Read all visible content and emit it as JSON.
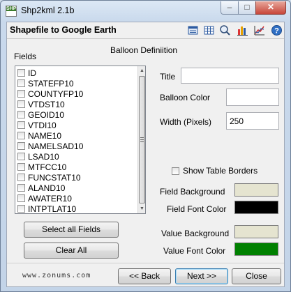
{
  "window": {
    "title": "Shp2kml 2.1b",
    "app_icon_text": "SHP"
  },
  "header": {
    "title": "Shapefile to Google Earth",
    "toolbar_icons": [
      "table-view-icon",
      "grid-icon",
      "search-icon",
      "bar-chart-icon",
      "line-chart-icon",
      "help-icon"
    ]
  },
  "balloon": {
    "heading": "Balloon Definiition"
  },
  "fields": {
    "label": "Fields",
    "items": [
      "ID",
      "STATEFP10",
      "COUNTYFP10",
      "VTDST10",
      "GEOID10",
      "VTDI10",
      "NAME10",
      "NAMELSAD10",
      "LSAD10",
      "MTFCC10",
      "FUNCSTAT10",
      "ALAND10",
      "AWATER10",
      "INTPTLAT10"
    ],
    "select_all_label": "Select all Fields",
    "clear_all_label": "Clear All"
  },
  "form": {
    "title_label": "Title",
    "title_value": "",
    "balloon_color_label": "Balloon Color",
    "balloon_color": "#ffffff",
    "width_label": "Width (Pixels)",
    "width_value": "250",
    "show_table_borders_label": "Show Table Borders",
    "show_table_borders_checked": false,
    "field_background_label": "Field Background",
    "field_background_color": "#e5e4d0",
    "field_font_color_label": "Field Font Color",
    "field_font_color": "#000000",
    "value_background_label": "Value Background",
    "value_background_color": "#e5e4d0",
    "value_font_color_label": "Value Font Color",
    "value_font_color": "#008000"
  },
  "footer": {
    "brand": "www.zonums.com",
    "back_label": "<< Back",
    "next_label": "Next >>",
    "close_label": "Close"
  }
}
